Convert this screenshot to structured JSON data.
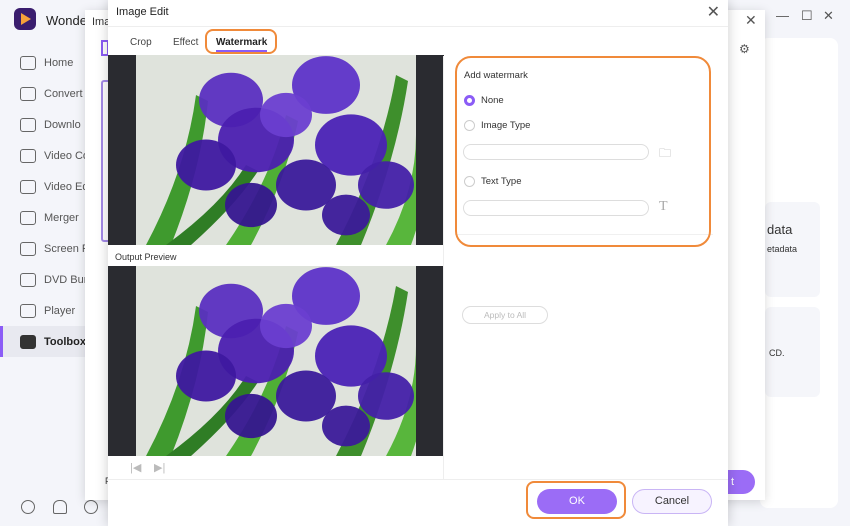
{
  "app": {
    "name": "Wonder",
    "window_controls": [
      "minimize",
      "maximize",
      "close"
    ]
  },
  "sidebar": {
    "items": [
      {
        "label": "Home",
        "icon": "home-icon"
      },
      {
        "label": "Convert",
        "icon": "converter-icon"
      },
      {
        "label": "Downlo",
        "icon": "download-icon"
      },
      {
        "label": "Video Co",
        "icon": "video-compressor-icon"
      },
      {
        "label": "Video Ed",
        "icon": "video-editor-icon"
      },
      {
        "label": "Merger",
        "icon": "merger-icon"
      },
      {
        "label": "Screen R",
        "icon": "screen-recorder-icon"
      },
      {
        "label": "DVD Bur",
        "icon": "dvd-burner-icon"
      },
      {
        "label": "Player",
        "icon": "player-icon"
      },
      {
        "label": "Toolbox",
        "icon": "toolbox-icon",
        "active": true
      }
    ],
    "bottom_icons": [
      "help-icon",
      "bell-icon",
      "support-icon"
    ]
  },
  "background": {
    "dialog_title": "Ima",
    "card1_title": "data",
    "card1_sub": "etadata",
    "card2_text": "CD.",
    "button_fragment": "t",
    "footer_fragment": "F"
  },
  "dialog": {
    "title": "Image Edit",
    "tabs": [
      {
        "label": "Crop"
      },
      {
        "label": "Effect"
      },
      {
        "label": "Watermark",
        "active": true
      }
    ],
    "output_preview_label": "Output Preview",
    "watermark": {
      "heading": "Add watermark",
      "options": [
        {
          "label": "None",
          "selected": true
        },
        {
          "label": "Image Type",
          "selected": false
        },
        {
          "label": "Text Type",
          "selected": false
        }
      ],
      "image_path": "",
      "text_value": ""
    },
    "apply_all": "Apply to All",
    "ok": "OK",
    "cancel": "Cancel"
  },
  "colors": {
    "accent": "#8b5cf6",
    "highlight": "#f08a3a"
  }
}
